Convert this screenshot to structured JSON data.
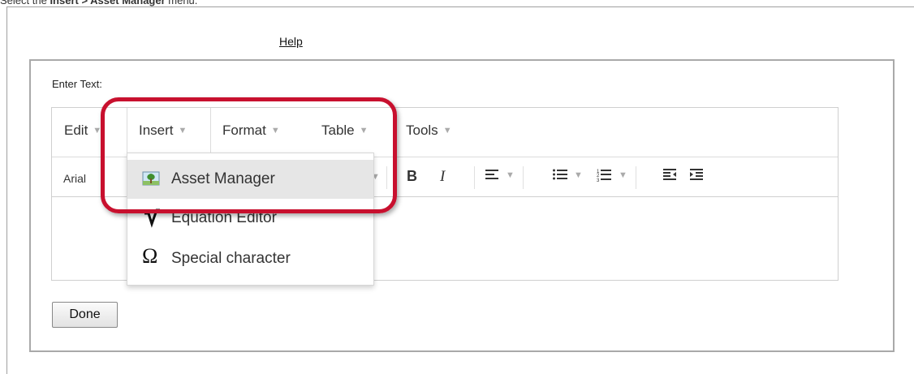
{
  "instruction": {
    "prefix": "Select the ",
    "bold": "Insert > Asset Manager",
    "suffix": " menu."
  },
  "help_link": "Help",
  "dialog": {
    "label": "Enter Text:",
    "done_label": "Done"
  },
  "menubar": {
    "items": [
      {
        "label": "Edit"
      },
      {
        "label": "Insert"
      },
      {
        "label": "Format"
      },
      {
        "label": "Table"
      },
      {
        "label": "Tools"
      }
    ]
  },
  "toolbar": {
    "font_family": "Arial",
    "bold_label": "B",
    "italic_label": "I"
  },
  "insert_menu": {
    "items": [
      {
        "label": "Asset Manager",
        "icon": "asset-manager-icon",
        "highlighted": true
      },
      {
        "label": "Equation Editor",
        "icon": "equation-icon",
        "highlighted": false
      },
      {
        "label": "Special character",
        "icon": "omega-icon",
        "highlighted": false
      }
    ]
  },
  "colors": {
    "callout": "#c8102e",
    "hover": "#e6e6e6"
  }
}
